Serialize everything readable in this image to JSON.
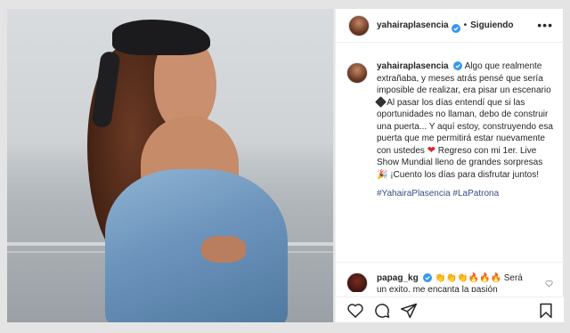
{
  "post": {
    "username": "yahairaplasencia",
    "follow_status": "Siguiendo",
    "more_label": "•••",
    "caption_part1": "Algo que realmente extrañaba, y meses atrás pensé que sería imposible de realizar, era pisar un escenario",
    "caption_part2": " Al pasar los días entendí que si las oportunidades no llaman, debo de construir una puerta... Y aquí estoy, construyendo esa puerta que me permitirá estar nuevamente con ustedes ",
    "caption_part3": " Regreso con mi 1er. Live Show Mundial lleno de grandes sorpresas ",
    "caption_part4": " ¡Cuento los días para disfrutar juntos!",
    "heart_emoji": "❤",
    "party_emoji": "🎉",
    "hashtags": "#YahairaPlasencia #LaPatrona"
  },
  "reply": {
    "username": "papag_kg",
    "emojis": "👏👏👏🔥🔥🔥",
    "text": "Será un exito, me encanta la pasión"
  },
  "colors": {
    "verified": "#3897f0",
    "heart": "#e0262d",
    "hashtag": "#385185"
  },
  "icons": [
    "heart-icon",
    "comment-icon",
    "share-icon",
    "bookmark-icon",
    "reply-like-icon"
  ]
}
